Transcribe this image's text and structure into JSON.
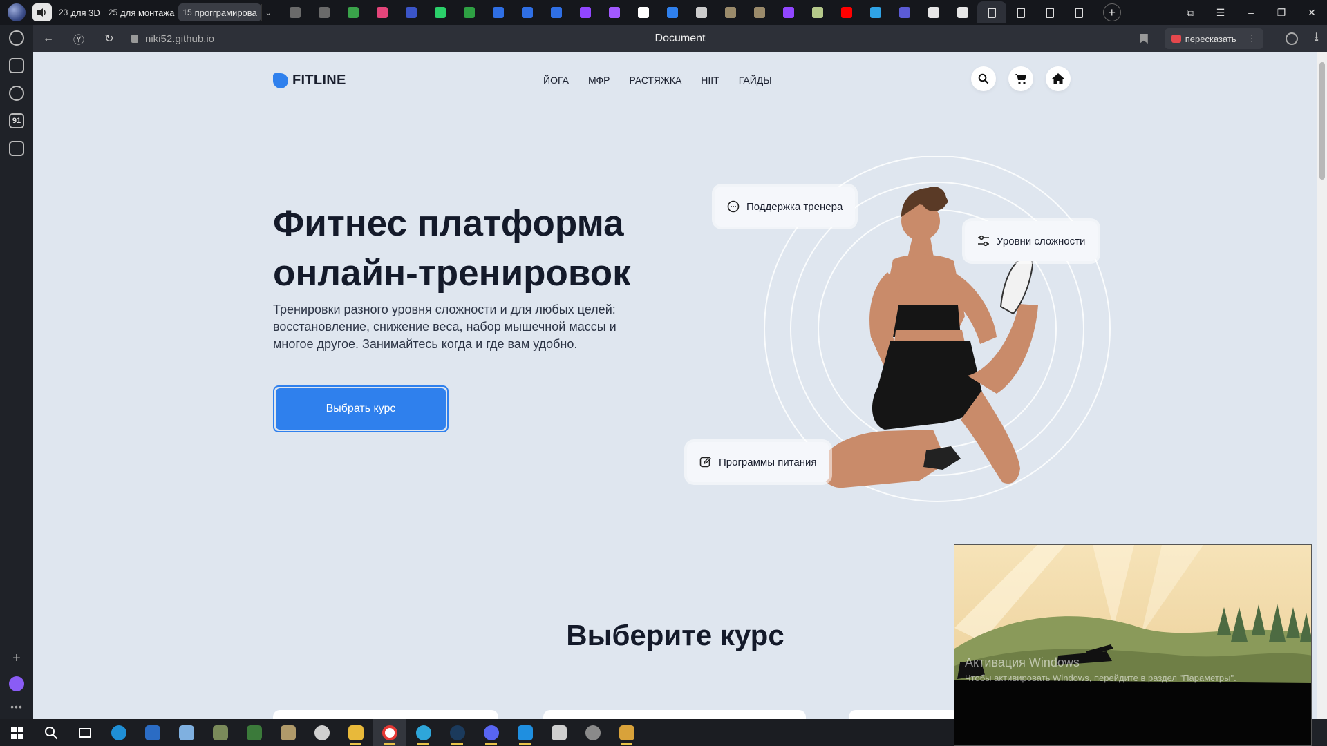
{
  "browser": {
    "tab_groups": [
      {
        "count": "23",
        "label": "для 3D"
      },
      {
        "count": "25",
        "label": "для монтажа"
      },
      {
        "count": "15",
        "label": "прогграмирова"
      }
    ],
    "pinned_tab_colors": [
      "#6a6a6a",
      "#6a6a6a",
      "#3aa34a",
      "#e4457a",
      "#3b55c8",
      "#2bd06a",
      "#2ea043",
      "#2f6fe4",
      "#2f6fe4",
      "#2f6fe4",
      "#9146ff",
      "#a259ff",
      "#ffffff",
      "#2f80ed",
      "#cccccc",
      "#9a8a6a",
      "#9a8a6a",
      "#9146ff",
      "#b5c98a",
      "#ff0000",
      "#2fa3e6",
      "#5b5bd6",
      "#e6e6e6",
      "#e6e6e6"
    ],
    "url": "niki52.github.io",
    "page_title": "Document",
    "retell_label": "пересказать"
  },
  "sidebar": {
    "icons": [
      "history-icon",
      "collections-icon",
      "media-icon",
      "counter-icon",
      "screenshot-icon"
    ],
    "counter_label": "91"
  },
  "site": {
    "brand": "FITLINE",
    "nav": [
      "ЙОГА",
      "МФР",
      "РАСТЯЖКА",
      "HIIT",
      "ГАЙДЫ"
    ],
    "hero": {
      "title": "Фитнес платформа онлайн-тренировок",
      "text": "Тренировки разного уровня сложности и для любых целей: восстановление, снижение веса, набор мышечной массы и многое другое. Занимайтесь когда и где вам удобно.",
      "cta": "Выбрать курс"
    },
    "features": {
      "support": "Поддержка тренера",
      "levels": "Уровни сложности",
      "nutrition": "Программы питания"
    },
    "courses_title": "Выберите курс",
    "accent_color": "#2f80ed"
  },
  "pip": {
    "watermark_title": "Активация Windows",
    "watermark_text": "Чтобы активировать Windows, перейдите в раздел \"Параметры\"."
  }
}
